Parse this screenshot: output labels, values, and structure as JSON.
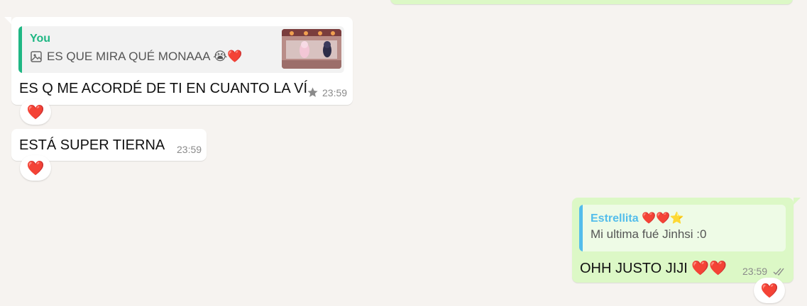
{
  "colors": {
    "incoming_bubble": "#ffffff",
    "outgoing_bubble": "#dcf8c6",
    "reply_you_accent": "#1fb784",
    "reply_contact_accent": "#53bdeb",
    "heart": "#e0242f",
    "star": "#f5b301",
    "read_ticks": "#8a8a8a"
  },
  "messages": [
    {
      "direction": "incoming",
      "reply": {
        "author": "You",
        "icon": "image-icon",
        "text": "ES QUE MIRA QUÉ MONAAA 😭❤️"
      },
      "text": "ES Q ME ACORDÉ DE TI EN CUANTO LA VÍ",
      "starred": true,
      "time": "23:59",
      "reaction": "❤️"
    },
    {
      "direction": "incoming",
      "text": "ESTÁ SUPER TIERNA",
      "time": "23:59",
      "reaction": "❤️"
    },
    {
      "direction": "outgoing",
      "reply": {
        "author": "Estrellita ❤️❤️⭐",
        "text": "Mi ultima fué Jinhsi :0"
      },
      "text": "OHH JUSTO JIJI ❤️❤️",
      "time": "23:59",
      "status": "read-ticks-icon",
      "reaction": "❤️"
    }
  ]
}
